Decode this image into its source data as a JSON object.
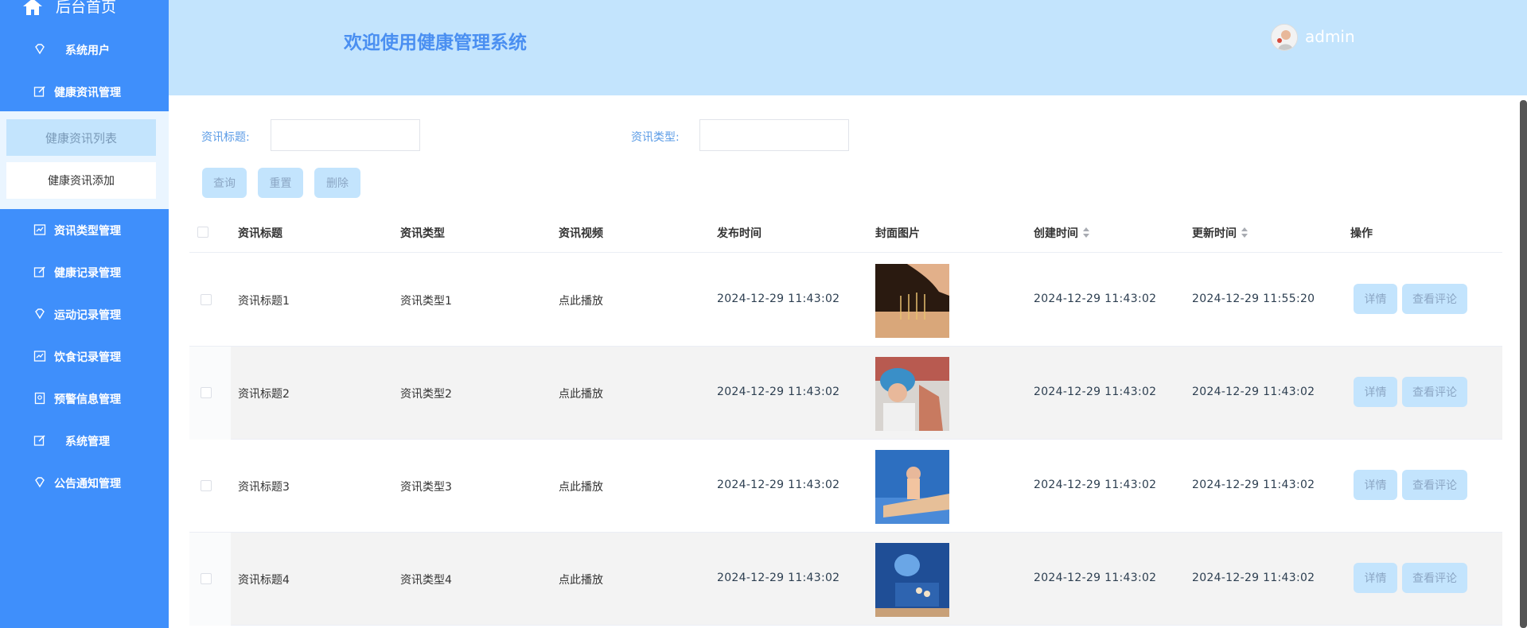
{
  "sidebar": {
    "home_label": "后台首页",
    "items": [
      {
        "label": "系统用户",
        "icon": "diamond-icon"
      },
      {
        "label": "健康资讯管理",
        "icon": "edit-icon"
      },
      {
        "label": "资讯类型管理",
        "icon": "chart-icon"
      },
      {
        "label": "健康记录管理",
        "icon": "edit-icon"
      },
      {
        "label": "运动记录管理",
        "icon": "diamond-icon"
      },
      {
        "label": "饮食记录管理",
        "icon": "chart-icon"
      },
      {
        "label": "预警信息管理",
        "icon": "badge-icon"
      },
      {
        "label": "系统管理",
        "icon": "edit-icon"
      },
      {
        "label": "公告通知管理",
        "icon": "diamond-icon"
      }
    ],
    "submenu": {
      "active": "健康资讯列表",
      "item": "健康资讯添加"
    }
  },
  "header": {
    "welcome": "欢迎使用健康管理系统",
    "username": "admin"
  },
  "search": {
    "title_label": "资讯标题:",
    "title_value": "",
    "type_label": "资讯类型:",
    "type_value": "",
    "query_button": "查询",
    "reset_button": "重置",
    "delete_button": "删除"
  },
  "table": {
    "headers": {
      "title": "资讯标题",
      "type": "资讯类型",
      "video": "资讯视频",
      "publish": "发布时间",
      "cover": "封面图片",
      "created": "创建时间",
      "updated": "更新时间",
      "actions": "操作"
    },
    "rows": [
      {
        "title": "资讯标题1",
        "type": "资讯类型1",
        "video": "点此播放",
        "publish": "2024-12-29 11:43:02",
        "created": "2024-12-29 11:43:02",
        "updated": "2024-12-29 11:55:20",
        "detail": "详情",
        "comments": "查看评论"
      },
      {
        "title": "资讯标题2",
        "type": "资讯类型2",
        "video": "点此播放",
        "publish": "2024-12-29 11:43:02",
        "created": "2024-12-29 11:43:02",
        "updated": "2024-12-29 11:43:02",
        "detail": "详情",
        "comments": "查看评论"
      },
      {
        "title": "资讯标题3",
        "type": "资讯类型3",
        "video": "点此播放",
        "publish": "2024-12-29 11:43:02",
        "created": "2024-12-29 11:43:02",
        "updated": "2024-12-29 11:43:02",
        "detail": "详情",
        "comments": "查看评论"
      },
      {
        "title": "资讯标题4",
        "type": "资讯类型4",
        "video": "点此播放",
        "publish": "2024-12-29 11:43:02",
        "created": "2024-12-29 11:43:02",
        "updated": "2024-12-29 11:43:02",
        "detail": "详情",
        "comments": "查看评论"
      }
    ]
  },
  "colors": {
    "sidebar": "#3f8ffb",
    "header": "#c3e4fd",
    "button": "#c3e4fd"
  }
}
